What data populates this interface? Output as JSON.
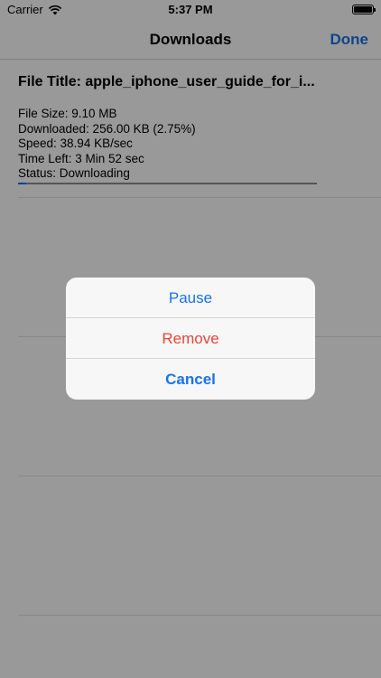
{
  "status_bar": {
    "carrier": "Carrier",
    "time": "5:37 PM"
  },
  "nav": {
    "title": "Downloads",
    "done_label": "Done"
  },
  "download": {
    "file_title": "File Title: apple_iphone_user_guide_for_i...",
    "file_size": "File Size: 9.10 MB",
    "downloaded": "Downloaded: 256.00 KB (2.75%)",
    "speed": "Speed: 38.94 KB/sec",
    "time_left": "Time Left: 3 Min 52 sec",
    "status": "Status: Downloading",
    "progress_percent": 2.75
  },
  "action_sheet": {
    "pause_label": "Pause",
    "remove_label": "Remove",
    "cancel_label": "Cancel"
  },
  "colors": {
    "accent": "#1a73e8",
    "destructive": "#e5453c",
    "cancel": "#1a73e8"
  },
  "icons": [
    "wifi-icon",
    "battery-icon"
  ]
}
